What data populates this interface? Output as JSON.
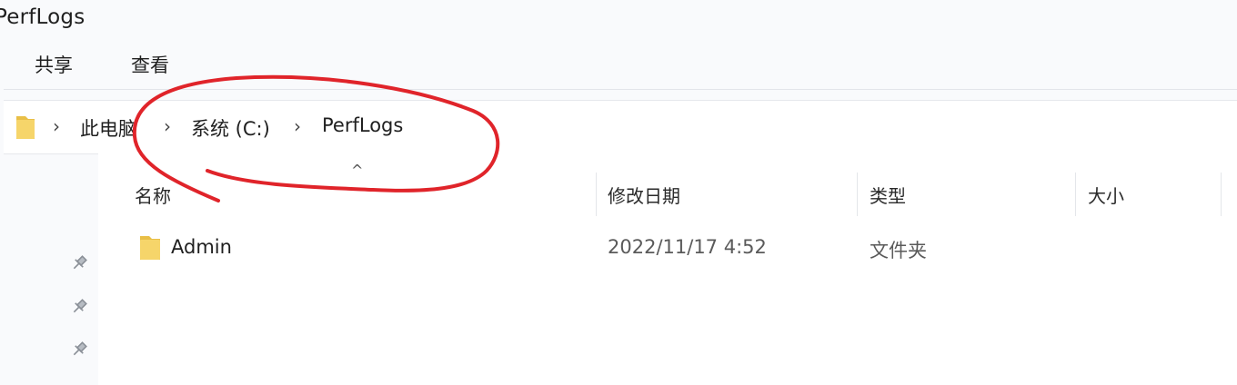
{
  "window": {
    "title": "PerfLogs"
  },
  "ribbon": {
    "tabs": [
      "共享",
      "查看"
    ]
  },
  "breadcrumb": {
    "items": [
      "此电脑",
      "系统 (C:)",
      "PerfLogs"
    ],
    "separator": "›"
  },
  "file_list": {
    "sort_indicator": "^",
    "columns": [
      "名称",
      "修改日期",
      "类型",
      "大小"
    ],
    "rows": [
      {
        "name": "Admin",
        "modified": "2022/11/17 4:52",
        "type": "文件夹",
        "size": ""
      }
    ]
  },
  "quick_access": {
    "pins": [
      "pin-icon",
      "pin-icon",
      "pin-icon"
    ]
  },
  "colors": {
    "folder_fill": "#f6d56a",
    "folder_back": "#e9bf47",
    "annotation": "#e0242a"
  }
}
